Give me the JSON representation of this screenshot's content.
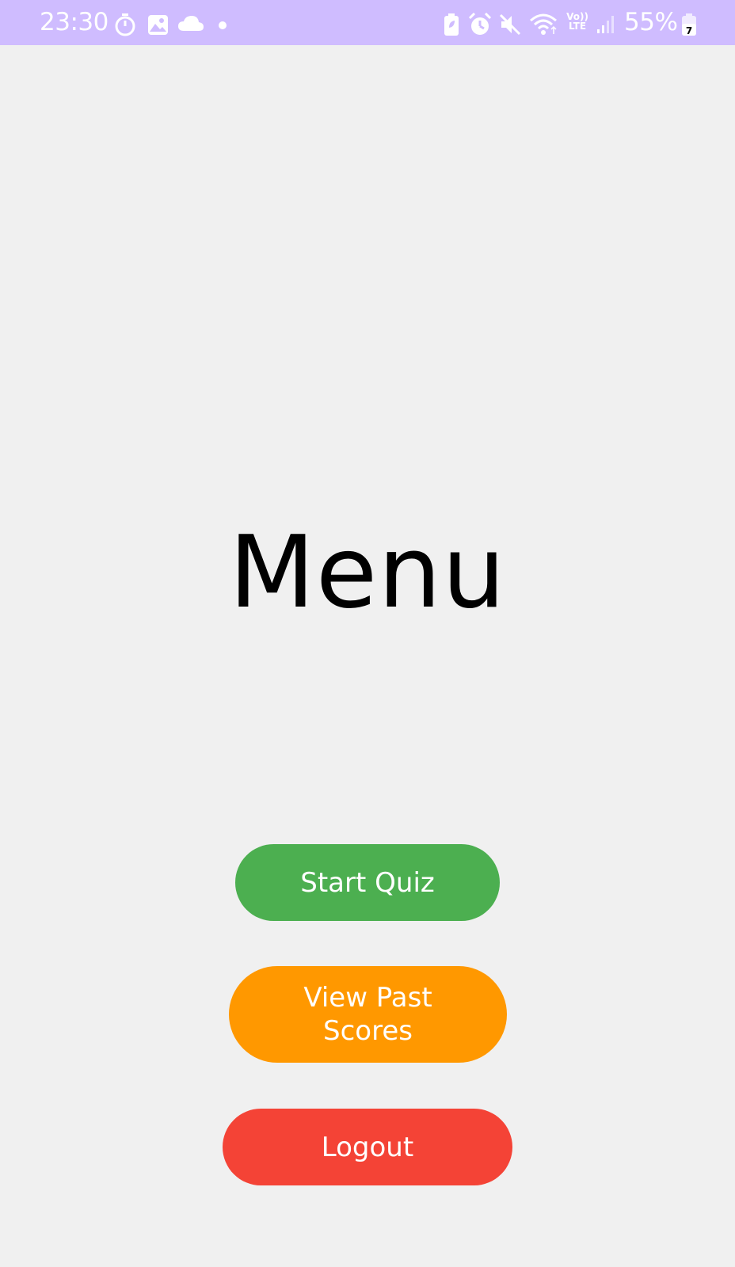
{
  "status_bar": {
    "time": "23:30",
    "network_label": "Vo)) LTE",
    "battery_percent": "55%",
    "battery_overlay": "7",
    "left_icons": [
      "timer-icon",
      "gallery-icon",
      "cloud-icon",
      "notification-dot-icon"
    ],
    "right_icons": [
      "battery-saver-icon",
      "alarm-icon",
      "mute-icon",
      "wifi-icon",
      "volte-icon",
      "signal-icon",
      "battery-icon"
    ],
    "background_color": "#cfbcff"
  },
  "main": {
    "title": "Menu",
    "buttons": {
      "start_quiz": {
        "label": "Start Quiz",
        "color": "#4caf50"
      },
      "view_past_scores": {
        "label": "View Past Scores",
        "color": "#ff9800"
      },
      "logout": {
        "label": "Logout",
        "color": "#f44336"
      }
    }
  }
}
